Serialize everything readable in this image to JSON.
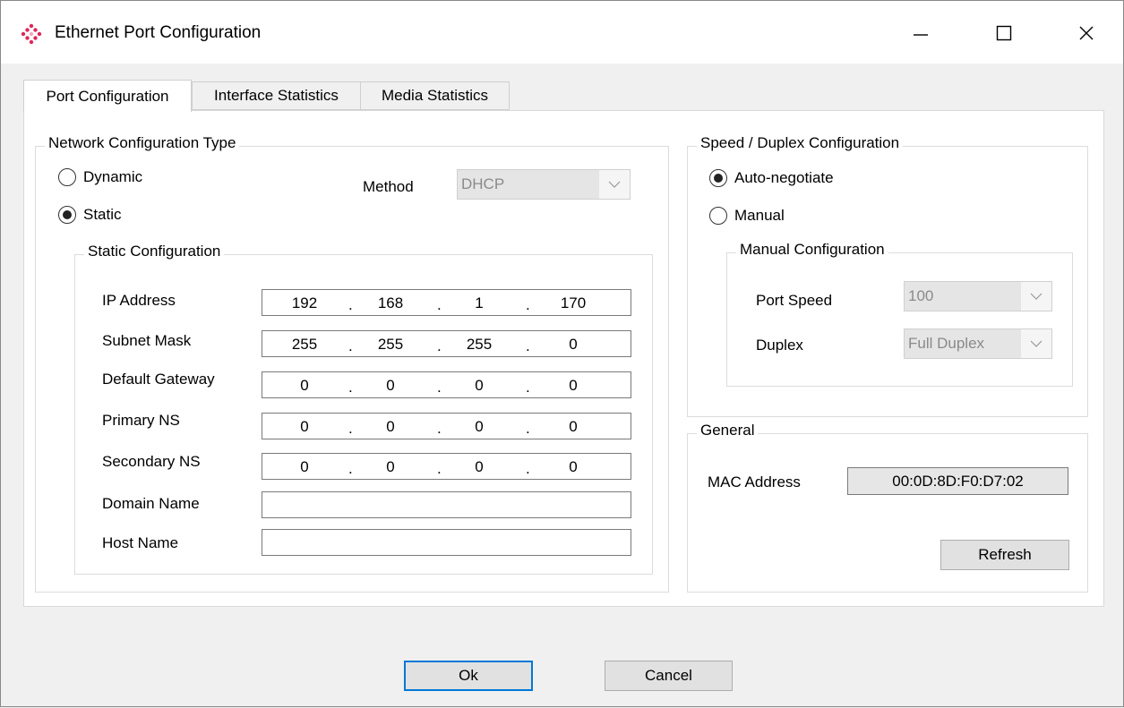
{
  "window": {
    "title": "Ethernet Port Configuration",
    "icon": "diamond-logo-icon"
  },
  "title_buttons": {
    "minimize_icon": "minimize-icon",
    "maximize_icon": "maximize-icon",
    "close_icon": "close-icon"
  },
  "tabs": [
    {
      "label": "Port Configuration",
      "active": true
    },
    {
      "label": "Interface Statistics",
      "active": false
    },
    {
      "label": "Media Statistics",
      "active": false
    }
  ],
  "network_config": {
    "legend": "Network Configuration Type",
    "dynamic_label": "Dynamic",
    "static_label": "Static",
    "selected": "Static",
    "method_label": "Method",
    "method_value": "DHCP"
  },
  "static_config": {
    "legend": "Static Configuration",
    "ip_label": "IP Address",
    "ip": [
      "192",
      "168",
      "1",
      "170"
    ],
    "subnet_label": "Subnet Mask",
    "subnet": [
      "255",
      "255",
      "255",
      "0"
    ],
    "gateway_label": "Default Gateway",
    "gateway": [
      "0",
      "0",
      "0",
      "0"
    ],
    "primary_ns_label": "Primary NS",
    "primary_ns": [
      "0",
      "0",
      "0",
      "0"
    ],
    "secondary_ns_label": "Secondary NS",
    "secondary_ns": [
      "0",
      "0",
      "0",
      "0"
    ],
    "domain_label": "Domain Name",
    "domain_value": "",
    "host_label": "Host Name",
    "host_value": ""
  },
  "speed_duplex": {
    "legend": "Speed / Duplex Configuration",
    "auto_label": "Auto-negotiate",
    "manual_label": "Manual",
    "selected": "Auto-negotiate",
    "manual_legend": "Manual Configuration",
    "port_speed_label": "Port Speed",
    "port_speed_value": "100",
    "duplex_label": "Duplex",
    "duplex_value": "Full Duplex"
  },
  "general": {
    "legend": "General",
    "mac_label": "MAC Address",
    "mac_value": "00:0D:8D:F0:D7:02",
    "refresh_label": "Refresh"
  },
  "footer": {
    "ok_label": "Ok",
    "cancel_label": "Cancel"
  },
  "colors": {
    "accent": "#0078d7",
    "logo": "#e0265a"
  }
}
